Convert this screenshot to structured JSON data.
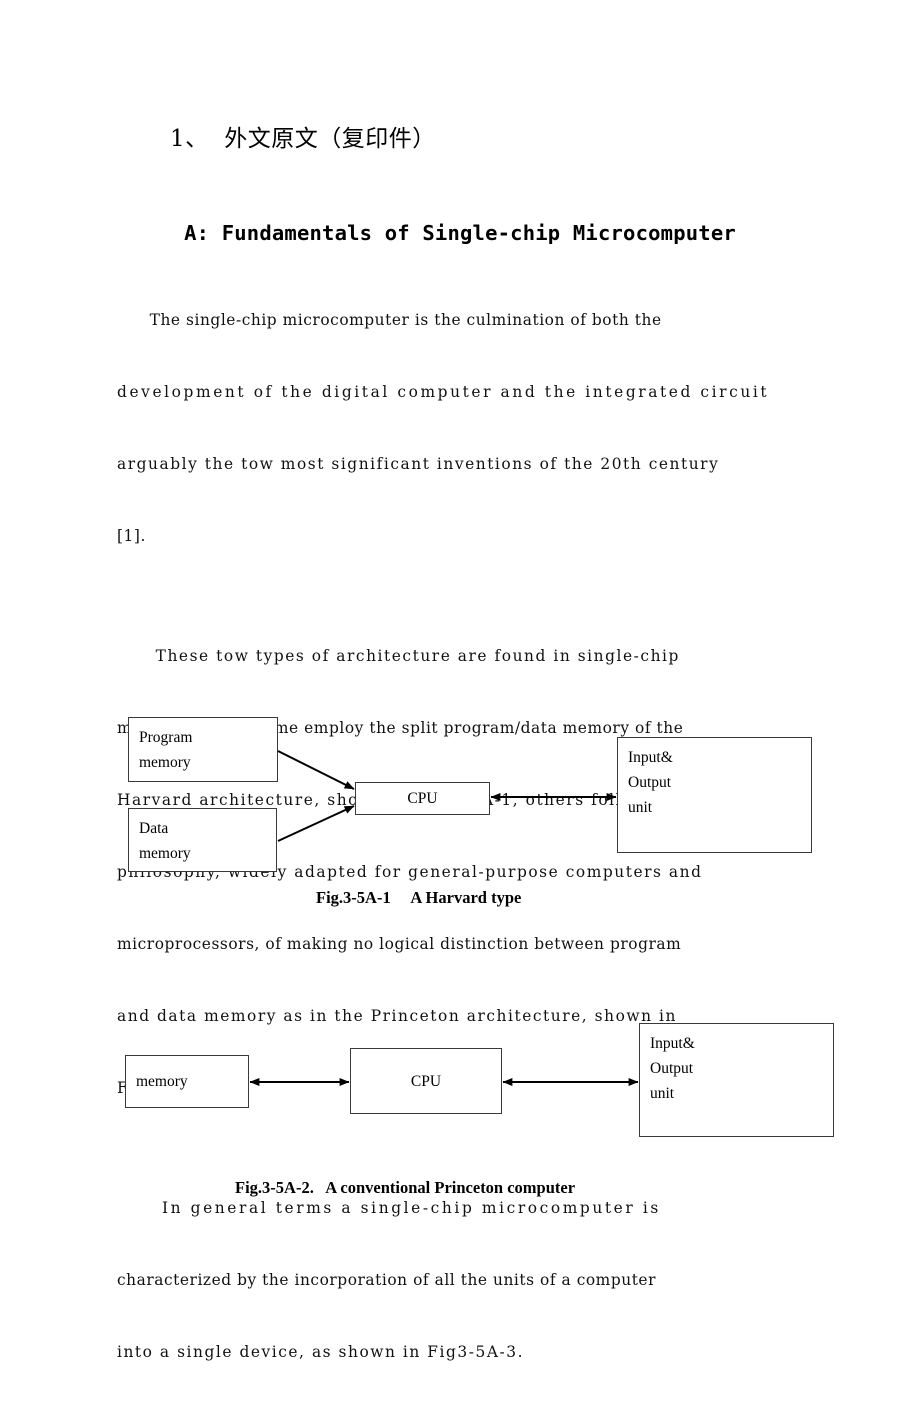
{
  "document": {
    "heading": "1、  外文原文（复印件）",
    "article_title": "A: Fundamentals of Single-chip Microcomputer",
    "paragraphs": [
      {
        "id": "p1",
        "lines": [
          "      The single-chip microcomputer is the culmination of both the",
          "development of the digital computer and the integrated circuit",
          "arguably the tow most significant inventions of the 20th century",
          "[1]."
        ]
      },
      {
        "id": "p2",
        "lines": [
          "      These tow types of architecture are found in single-chip",
          "microcomputer. Some employ the split program/data memory of the",
          "Harvard architecture, shown in Fig.3-5A-1, others follow the",
          "philosophy, widely adapted for general-purpose computers and",
          "microprocessors, of making no logical distinction between program",
          "and data memory as in the Princeton architecture, shown in",
          "Fig.3-5A-2."
        ]
      },
      {
        "id": "p3",
        "lines": [
          "      In general terms a single-chip microcomputer is",
          "characterized by the incorporation of all the units of a computer",
          "into a single device, as shown in Fig3-5A-3."
        ]
      }
    ]
  },
  "figures": [
    {
      "id": "fig-harvard",
      "caption": "Fig.3-5A-1     A Harvard type",
      "nodes": [
        {
          "id": "program-memory",
          "label": "Program\nmemory"
        },
        {
          "id": "data-memory",
          "label": "Data\nmemory"
        },
        {
          "id": "cpu",
          "label": "CPU"
        },
        {
          "id": "io-unit",
          "label": "Input&\nOutput\nunit"
        }
      ],
      "connections": [
        {
          "from": "program-memory",
          "to": "cpu",
          "style": "single-arrow"
        },
        {
          "from": "data-memory",
          "to": "cpu",
          "style": "single-arrow"
        },
        {
          "from": "cpu",
          "to": "io-unit",
          "style": "double-arrow"
        }
      ]
    },
    {
      "id": "fig-princeton",
      "caption": "Fig.3-5A-2.   A conventional Princeton computer",
      "nodes": [
        {
          "id": "memory",
          "label": "memory"
        },
        {
          "id": "cpu",
          "label": "CPU"
        },
        {
          "id": "io-unit",
          "label": "Input&\nOutput\nunit"
        }
      ],
      "connections": [
        {
          "from": "memory",
          "to": "cpu",
          "style": "double-arrow"
        },
        {
          "from": "cpu",
          "to": "io-unit",
          "style": "double-arrow"
        }
      ]
    }
  ],
  "colors": {
    "page_background": "#ffffff",
    "text": "#000000",
    "box_border": "#3a3a3a",
    "wire": "#000000"
  }
}
